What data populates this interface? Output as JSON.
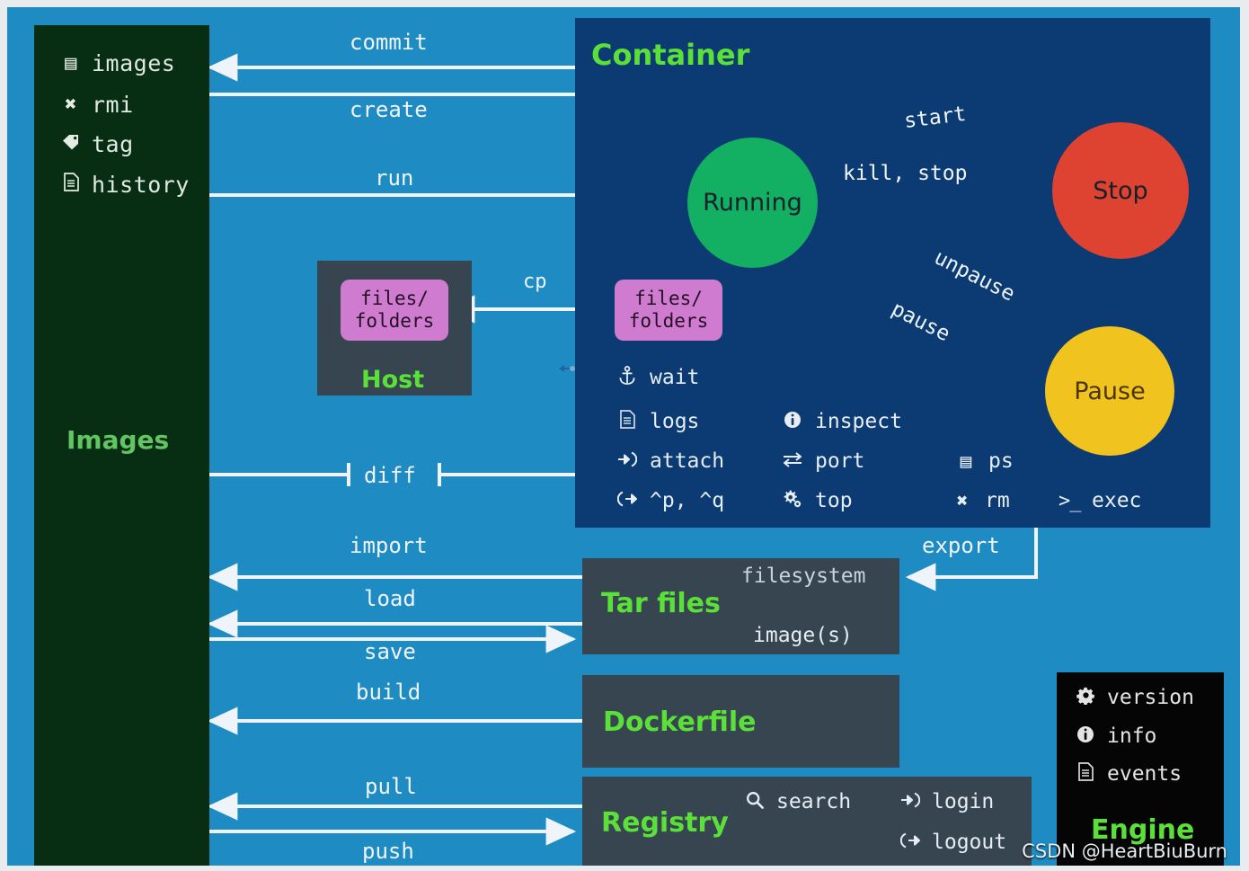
{
  "colors": {
    "background": "#1E8BC3",
    "images_panel": "#072E13",
    "container_panel": "#0B3B72",
    "dark_box": "#36454F",
    "engine_panel": "#050505",
    "green_text": "#5BE03A",
    "running": "#13AF62",
    "stop": "#DD4330",
    "pause": "#F1C31E",
    "files_folders": "#CE7BD0",
    "arrow": "#EEF4F9"
  },
  "images_panel": {
    "title": "Images",
    "commands": [
      {
        "icon": "list-icon",
        "glyph": "▤",
        "label": "images"
      },
      {
        "icon": "cross-icon",
        "glyph": "✖",
        "label": "rmi"
      },
      {
        "icon": "tag-icon",
        "glyph": "🏷",
        "label": "tag"
      },
      {
        "icon": "document-icon",
        "glyph": "🗎",
        "label": "history"
      }
    ]
  },
  "container_panel": {
    "title": "Container",
    "states": [
      {
        "name": "Running",
        "color": "#13AF62"
      },
      {
        "name": "Stop",
        "color": "#DD4330"
      },
      {
        "name": "Pause",
        "color": "#F1C31E"
      }
    ],
    "transitions": [
      {
        "label": "start",
        "from": "Stop",
        "to": "Running"
      },
      {
        "label": "kill, stop",
        "from": "Running",
        "to": "Stop"
      },
      {
        "label": "unpause",
        "from": "Pause",
        "to": "Running"
      },
      {
        "label": "pause",
        "from": "Running",
        "to": "Pause"
      }
    ],
    "files_folders_label": "files/\nfolders",
    "commands": [
      {
        "icon": "anchor-icon",
        "glyph": "⚓",
        "label": "wait"
      },
      {
        "icon": "document-icon",
        "glyph": "🗎",
        "label": "logs"
      },
      {
        "icon": "info-icon",
        "glyph": "❶",
        "label": "inspect"
      },
      {
        "icon": "sign-in-icon",
        "glyph": "→]",
        "label": "attach"
      },
      {
        "icon": "exchange-icon",
        "glyph": "⇄",
        "label": "port"
      },
      {
        "icon": "list-icon",
        "glyph": "▤",
        "label": "ps"
      },
      {
        "icon": "sign-out-icon",
        "glyph": "[→",
        "label": "^p, ^q"
      },
      {
        "icon": "gears-icon",
        "glyph": "⚙",
        "label": "top"
      },
      {
        "icon": "cross-icon",
        "glyph": "✖",
        "label": "rm"
      },
      {
        "icon": "terminal-icon",
        "glyph": ">_",
        "label": "exec"
      }
    ]
  },
  "host_panel": {
    "title": "Host",
    "files_folders_label": "files/\nfolders"
  },
  "tar_panel": {
    "title": "Tar files",
    "filesystem_label": "filesystem",
    "images_label": "image(s)"
  },
  "dockerfile_panel": {
    "title": "Dockerfile"
  },
  "registry_panel": {
    "title": "Registry",
    "commands": [
      {
        "icon": "search-icon",
        "glyph": "🔍",
        "label": "search"
      },
      {
        "icon": "sign-in-icon",
        "glyph": "→]",
        "label": "login"
      },
      {
        "icon": "sign-out-icon",
        "glyph": "[→",
        "label": "logout"
      }
    ]
  },
  "engine_panel": {
    "title": "Engine",
    "commands": [
      {
        "icon": "gear-icon",
        "glyph": "⚙",
        "label": "version"
      },
      {
        "icon": "info-icon",
        "glyph": "❶",
        "label": "info"
      },
      {
        "icon": "document-icon",
        "glyph": "🗎",
        "label": "events"
      }
    ]
  },
  "flow_labels": {
    "commit": "commit",
    "create": "create",
    "run": "run",
    "cp": "cp",
    "diff": "diff",
    "import": "import",
    "load": "load",
    "save": "save",
    "export": "export",
    "build": "build",
    "pull": "pull",
    "push": "push"
  },
  "watermark": "CSDN @HeartBiuBurn"
}
